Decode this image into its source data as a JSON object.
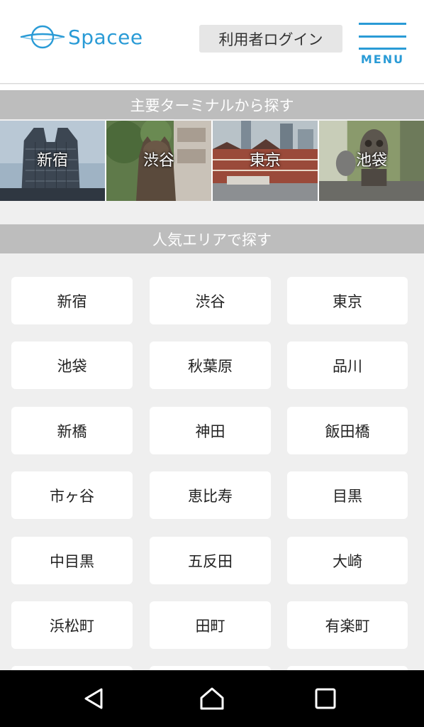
{
  "header": {
    "logo_text": "Spacee",
    "login_label": "利用者ログイン",
    "menu_label": "MENU",
    "brand_color": "#2a9bd6"
  },
  "terminals": {
    "title": "主要ターミナルから探す",
    "items": [
      {
        "label": "新宿"
      },
      {
        "label": "渋谷"
      },
      {
        "label": "東京"
      },
      {
        "label": "池袋"
      }
    ]
  },
  "areas": {
    "title": "人気エリアで探す",
    "items": [
      "新宿",
      "渋谷",
      "東京",
      "池袋",
      "秋葉原",
      "品川",
      "新橋",
      "神田",
      "飯田橋",
      "市ヶ谷",
      "恵比寿",
      "目黒",
      "中目黒",
      "五反田",
      "大崎",
      "浜松町",
      "田町",
      "有楽町"
    ]
  },
  "navbar": {
    "icons": [
      "back-icon",
      "home-icon",
      "recents-icon"
    ]
  }
}
